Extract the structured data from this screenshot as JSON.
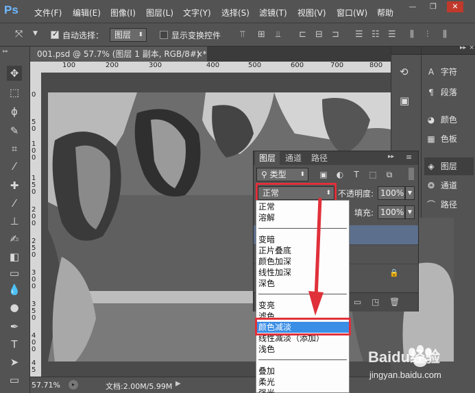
{
  "app": {
    "logo": "Ps"
  },
  "menu": [
    "文件(F)",
    "编辑(E)",
    "图像(I)",
    "图层(L)",
    "文字(Y)",
    "选择(S)",
    "滤镜(T)",
    "视图(V)",
    "窗口(W)",
    "帮助"
  ],
  "window_controls": {
    "minimize": "—",
    "restore": "❐",
    "close": "✕"
  },
  "options_bar": {
    "auto_select_label": "自动选择：",
    "auto_select_checked": true,
    "auto_select_target": "图层",
    "show_transform_label": "显示变换控件",
    "show_transform_checked": false
  },
  "document": {
    "tab_title": "001.psd @ 57.7% (图层 1 副本, RGB/8#) *",
    "close": "×",
    "zoom": "57.71%",
    "doc_info": "文档:2.00M/5.99M"
  },
  "rulers": {
    "h": [
      "100",
      "200",
      "300",
      "400",
      "500",
      "600",
      "700",
      "800"
    ],
    "v": [
      "0",
      "5",
      "0",
      "1",
      "0",
      "0",
      "1",
      "5",
      "0",
      "2",
      "0",
      "0",
      "2",
      "5",
      "0",
      "3",
      "0",
      "0",
      "3",
      "5",
      "0",
      "4",
      "0",
      "0",
      "4",
      "5",
      "0",
      "5",
      "0",
      "0"
    ]
  },
  "right_dock": {
    "items": [
      {
        "icon": "text-panel-icon",
        "label": "字符"
      },
      {
        "icon": "paragraph-icon",
        "label": "段落"
      },
      {
        "icon": "color-icon",
        "label": "颜色"
      },
      {
        "icon": "swatches-icon",
        "label": "色板"
      },
      {
        "icon": "layers-icon",
        "label": "图层"
      },
      {
        "icon": "channels-icon",
        "label": "通道"
      },
      {
        "icon": "paths-icon",
        "label": "路径"
      }
    ]
  },
  "layers_panel": {
    "tabs": [
      "图层",
      "通道",
      "路径"
    ],
    "active_tab": "图层",
    "filter_kind": "类型",
    "blend_mode": "正常",
    "opacity_label": "不透明度:",
    "opacity_value": "100%",
    "fill_label": "填充:",
    "fill_value": "100%"
  },
  "blend_dropdown": {
    "groups": [
      [
        "正常",
        "溶解"
      ],
      [
        "变暗",
        "正片叠底",
        "颜色加深",
        "线性加深",
        "深色"
      ],
      [
        "变亮",
        "滤色",
        "颜色减淡",
        "线性减淡（添加）",
        "浅色"
      ],
      [
        "叠加",
        "柔光",
        "强光"
      ]
    ],
    "selected": "颜色减淡"
  },
  "watermark": {
    "brand": "Baidu经验",
    "url": "jingyan.baidu.com"
  },
  "colors": {
    "highlight": "#e0303a",
    "selection": "#3a8ee6",
    "ui_bg": "#535353"
  }
}
